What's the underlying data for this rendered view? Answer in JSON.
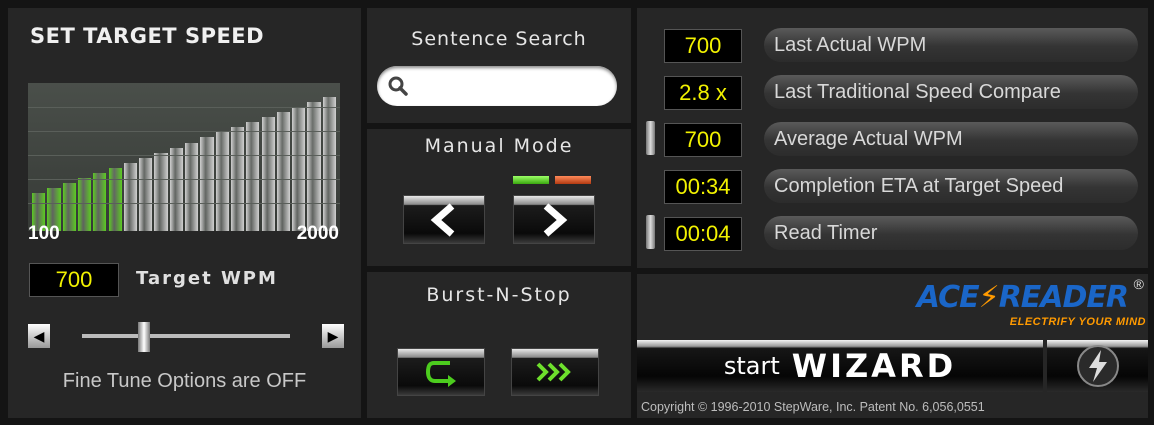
{
  "speed": {
    "title": "SET TARGET SPEED",
    "min_label": "100",
    "max_label": "2000",
    "target_value": "700",
    "target_label": "Target WPM",
    "fine_tune": "Fine Tune Options are OFF",
    "slider_value_fraction": 0.3,
    "bars": {
      "count": 20,
      "active": 6,
      "active_color": "#5ccc22",
      "inactive_color": "#d0d0d0"
    }
  },
  "search": {
    "title": "Sentence Search",
    "placeholder": ""
  },
  "manual": {
    "title": "Manual Mode"
  },
  "burst": {
    "title": "Burst-N-Stop"
  },
  "stats": [
    {
      "value": "700",
      "label": "Last Actual WPM"
    },
    {
      "value": "2.8 x",
      "label": "Last Traditional Speed Compare"
    },
    {
      "value": "700",
      "label": "Average Actual WPM"
    },
    {
      "value": "00:34",
      "label": "Completion ETA at Target Speed"
    },
    {
      "value": "00:04",
      "label": "Read Timer"
    }
  ],
  "brand": {
    "ace": "ACE",
    "reader": "READER",
    "reg": "®",
    "tagline": "ELECTRIFY YOUR MIND"
  },
  "wizard": {
    "start": "start",
    "wizard": "WIZARD"
  },
  "copyright": "Copyright © 1996-2010 StepWare, Inc. Patent No. 6,056,0551",
  "colors": {
    "lcd_text": "#f2f200",
    "brand_blue": "#1a66c8",
    "brand_orange": "#ff9a00",
    "indicator_green": "#5ccc22",
    "indicator_red": "#cc4a22"
  }
}
